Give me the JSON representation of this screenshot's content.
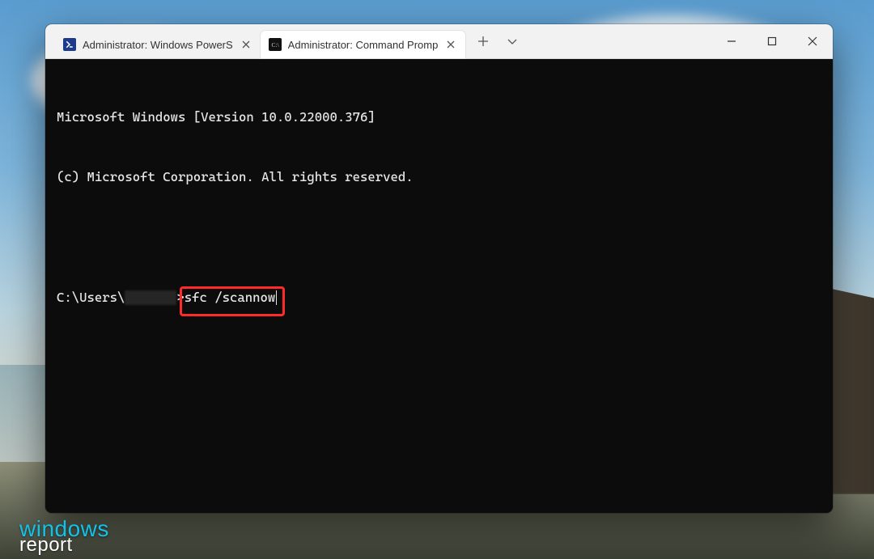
{
  "watermark": {
    "line1": "windows",
    "line2": "report"
  },
  "titlebar": {
    "tabs": [
      {
        "label": "Administrator: Windows PowerS",
        "icon": "powershell-icon",
        "active": false
      },
      {
        "label": "Administrator: Command Promp",
        "icon": "cmd-icon",
        "active": true
      }
    ],
    "newtab_tooltip": "New tab",
    "dropdown_tooltip": "New tab dropdown",
    "min_tooltip": "Minimize",
    "max_tooltip": "Maximize",
    "close_tooltip": "Close"
  },
  "terminal": {
    "line1": "Microsoft Windows [Version 10.0.22000.376]",
    "line2": "(c) Microsoft Corporation. All rights reserved.",
    "prompt_prefix": "C:\\Users\\",
    "prompt_suffix": ">",
    "command": "sfc /scannow"
  },
  "highlight": {
    "target": "command"
  }
}
